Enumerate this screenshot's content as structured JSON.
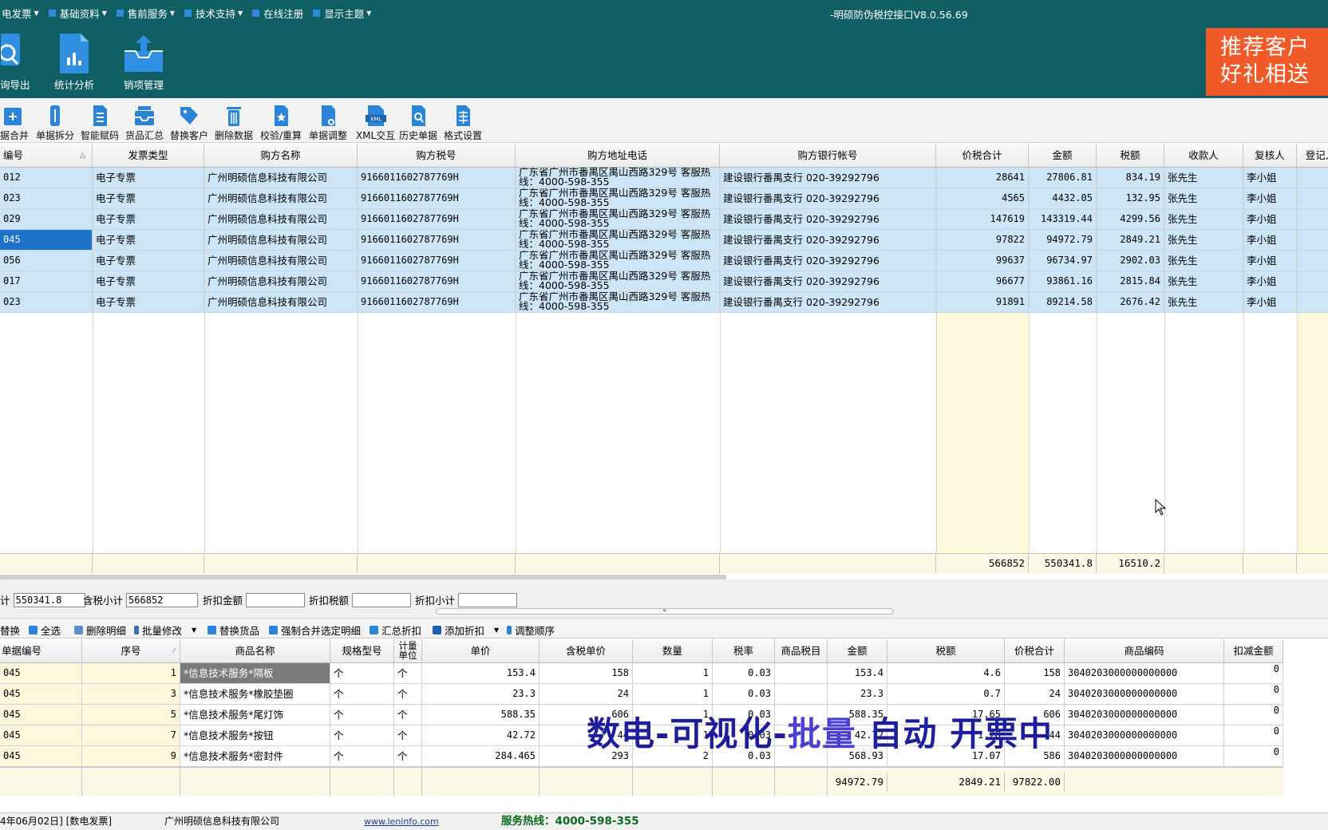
{
  "menu": [
    {
      "label": "电发票"
    },
    {
      "label": "基础资料"
    },
    {
      "label": "售前服务"
    },
    {
      "label": "技术支持"
    },
    {
      "label": "在线注册"
    },
    {
      "label": "显示主题"
    }
  ],
  "app_title": "-明硕防伪税控接口V8.0.56.69",
  "big_buttons": [
    {
      "label": "询导出",
      "icon": "search-icon"
    },
    {
      "label": "统计分析",
      "icon": "chart-document-icon"
    },
    {
      "label": "销项管理",
      "icon": "inbox-upload-icon"
    }
  ],
  "promo": {
    "line1": "推荐客户",
    "line2": "好礼相送",
    "color": "#f05a28"
  },
  "toolbar": [
    {
      "label": "据合并"
    },
    {
      "label": "单据拆分"
    },
    {
      "label": "智能赋码"
    },
    {
      "label": "货品汇总"
    },
    {
      "label": "替换客户"
    },
    {
      "label": "删除数据"
    },
    {
      "label": "校验/重算"
    },
    {
      "label": "单据调整"
    },
    {
      "label": "XML交互"
    },
    {
      "label": "历史单据"
    },
    {
      "label": "格式设置"
    }
  ],
  "invoice_grid": {
    "columns": [
      "编号",
      "发票类型",
      "购方名称",
      "购方税号",
      "购方地址电话",
      "购方银行帐号",
      "价税合计",
      "金额",
      "税额",
      "收款人",
      "复核人",
      "登记人"
    ],
    "rows": [
      {
        "no": "012",
        "type": "电子专票",
        "buyer": "广州明硕信息科技有限公司",
        "tax_id": "9166011602787769H",
        "address": "广东省广州市番禺区禺山西路329号 客服热线：4000-598-355",
        "bank": "建设银行番禺支行 020-39292796",
        "total": "28641",
        "amount": "27806.81",
        "tax": "834.19",
        "payee": "张先生",
        "reviewer": "李小姐"
      },
      {
        "no": "023",
        "type": "电子专票",
        "buyer": "广州明硕信息科技有限公司",
        "tax_id": "9166011602787769H",
        "address": "广东省广州市番禺区禺山西路329号 客服热线：4000-598-355",
        "bank": "建设银行番禺支行 020-39292796",
        "total": "4565",
        "amount": "4432.05",
        "tax": "132.95",
        "payee": "张先生",
        "reviewer": "李小姐"
      },
      {
        "no": "029",
        "type": "电子专票",
        "buyer": "广州明硕信息科技有限公司",
        "tax_id": "9166011602787769H",
        "address": "广东省广州市番禺区禺山西路329号 客服热线：4000-598-355",
        "bank": "建设银行番禺支行 020-39292796",
        "total": "147619",
        "amount": "143319.44",
        "tax": "4299.56",
        "payee": "张先生",
        "reviewer": "李小姐"
      },
      {
        "no": "045",
        "type": "电子专票",
        "buyer": "广州明硕信息科技有限公司",
        "tax_id": "9166011602787769H",
        "address": "广东省广州市番禺区禺山西路329号 客服热线：4000-598-355",
        "bank": "建设银行番禺支行 020-39292796",
        "total": "97822",
        "amount": "94972.79",
        "tax": "2849.21",
        "payee": "张先生",
        "reviewer": "李小姐"
      },
      {
        "no": "056",
        "type": "电子专票",
        "buyer": "广州明硕信息科技有限公司",
        "tax_id": "9166011602787769H",
        "address": "广东省广州市番禺区禺山西路329号 客服热线：4000-598-355",
        "bank": "建设银行番禺支行 020-39292796",
        "total": "99637",
        "amount": "96734.97",
        "tax": "2902.03",
        "payee": "张先生",
        "reviewer": "李小姐"
      },
      {
        "no": "017",
        "type": "电子专票",
        "buyer": "广州明硕信息科技有限公司",
        "tax_id": "9166011602787769H",
        "address": "广东省广州市番禺区禺山西路329号 客服热线：4000-598-355",
        "bank": "建设银行番禺支行 020-39292796",
        "total": "96677",
        "amount": "93861.16",
        "tax": "2815.84",
        "payee": "张先生",
        "reviewer": "李小姐"
      },
      {
        "no": "023",
        "type": "电子专票",
        "buyer": "广州明硕信息科技有限公司",
        "tax_id": "9166011602787769H",
        "address": "广东省广州市番禺区禺山西路329号 客服热线：4000-598-355",
        "bank": "建设银行番禺支行 020-39292796",
        "total": "91891",
        "amount": "89214.58",
        "tax": "2676.42",
        "payee": "张先生",
        "reviewer": "李小姐"
      }
    ],
    "totals": {
      "total": "566852",
      "amount": "550341.8",
      "tax": "16510.2"
    }
  },
  "subtotals": {
    "amount_label": "计",
    "amount_value": "550341.8",
    "taxed_label": "含税小计",
    "taxed_value": "566852",
    "disc_amount_label": "折扣金额",
    "disc_amount_value": "",
    "disc_tax_label": "折扣税额",
    "disc_tax_value": "",
    "disc_sub_label": "折扣小计",
    "disc_sub_value": ""
  },
  "actions": [
    {
      "label": "替换"
    },
    {
      "label": "全选"
    },
    {
      "label": "删除明细"
    },
    {
      "label": "批量修改"
    },
    {
      "label": "替换货品"
    },
    {
      "label": "强制合并选定明细"
    },
    {
      "label": "汇总折扣"
    },
    {
      "label": "添加折扣"
    },
    {
      "label": "调整顺序"
    }
  ],
  "detail_grid": {
    "columns": [
      "单据编号",
      "序号",
      "商品名称",
      "规格型号",
      "计量单位",
      "单价",
      "含税单价",
      "数量",
      "税率",
      "商品税目",
      "金额",
      "税额",
      "价税合计",
      "商品编码",
      "扣减金额"
    ],
    "rows": [
      {
        "doc": "045",
        "seq": "1",
        "name": "*信息技术服务*隔板",
        "spec": "个",
        "unit": "个",
        "price": "153.4",
        "taxed_price": "158",
        "qty": "1",
        "rate": "0.03",
        "item": "",
        "amount": "153.4",
        "tax": "4.6",
        "total": "158",
        "code": "3040203000000000000",
        "deduct": "0"
      },
      {
        "doc": "045",
        "seq": "3",
        "name": "*信息技术服务*橡胶垫圈",
        "spec": "个",
        "unit": "个",
        "price": "23.3",
        "taxed_price": "24",
        "qty": "1",
        "rate": "0.03",
        "item": "",
        "amount": "23.3",
        "tax": "0.7",
        "total": "24",
        "code": "3040203000000000000",
        "deduct": "0"
      },
      {
        "doc": "045",
        "seq": "5",
        "name": "*信息技术服务*尾灯饰",
        "spec": "个",
        "unit": "个",
        "price": "588.35",
        "taxed_price": "606",
        "qty": "1",
        "rate": "0.03",
        "item": "",
        "amount": "588.35",
        "tax": "17.65",
        "total": "606",
        "code": "3040203000000000000",
        "deduct": "0"
      },
      {
        "doc": "045",
        "seq": "7",
        "name": "*信息技术服务*按钮",
        "spec": "个",
        "unit": "个",
        "price": "42.72",
        "taxed_price": "44",
        "qty": "1",
        "rate": "0.03",
        "item": "",
        "amount": "42.72",
        "tax": "1.28",
        "total": "44",
        "code": "3040203000000000000",
        "deduct": "0"
      },
      {
        "doc": "045",
        "seq": "9",
        "name": "*信息技术服务*密封件",
        "spec": "个",
        "unit": "个",
        "price": "284.465",
        "taxed_price": "293",
        "qty": "2",
        "rate": "0.03",
        "item": "",
        "amount": "568.93",
        "tax": "17.07",
        "total": "586",
        "code": "3040203000000000000",
        "deduct": "0"
      }
    ],
    "totals": {
      "amount": "94972.79",
      "tax": "2849.21",
      "total": "97822.00"
    }
  },
  "overlay": {
    "part1": "数电-可视化-",
    "part2": "批量",
    "part3": " 自动  开票中"
  },
  "status": {
    "date": "4年06月02日] [数电发票]",
    "company": "广州明硕信息科技有限公司",
    "website": "www.leninfo.com",
    "hotline": "服务热线：4000-598-355"
  }
}
